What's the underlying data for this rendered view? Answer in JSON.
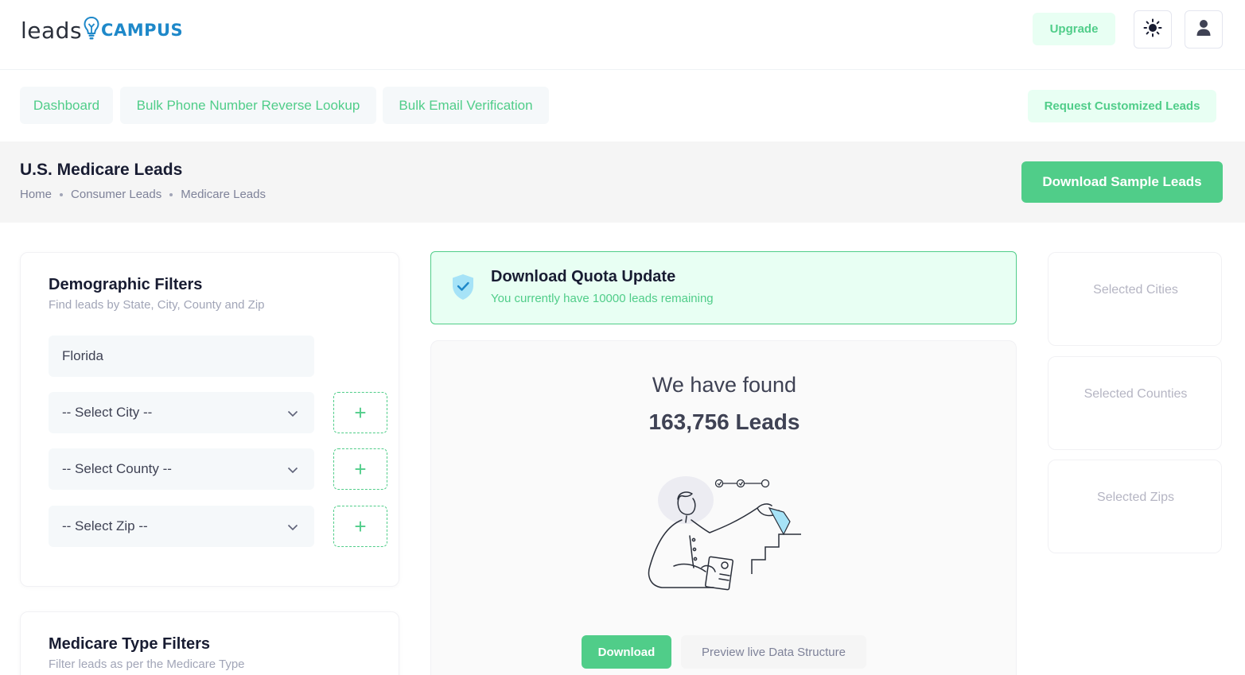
{
  "brand": {
    "logo_leads": "leads",
    "logo_campus": "CAMPUS"
  },
  "header": {
    "upgrade_label": "Upgrade",
    "theme_icon": "sun-icon",
    "user_icon": "user-icon"
  },
  "nav": {
    "tabs": [
      {
        "label": "Dashboard"
      },
      {
        "label": "Bulk Phone Number Reverse Lookup"
      },
      {
        "label": "Bulk Email Verification"
      }
    ],
    "request_label": "Request Customized Leads"
  },
  "toolbar": {
    "title": "U.S. Medicare Leads",
    "breadcrumb": [
      "Home",
      "Consumer Leads",
      "Medicare Leads"
    ],
    "sample_label": "Download Sample Leads"
  },
  "demographic": {
    "title": "Demographic Filters",
    "subtitle": "Find leads by State, City, County and Zip",
    "state_value": "Florida",
    "city_placeholder": "-- Select City --",
    "county_placeholder": "-- Select County --",
    "zip_placeholder": "-- Select Zip --",
    "add_symbol": "+"
  },
  "medicare_type": {
    "title": "Medicare Type Filters",
    "subtitle": "Filter leads as per the Medicare Type"
  },
  "quota": {
    "title": "Download Quota Update",
    "message": "You currently have 10000 leads remaining"
  },
  "results": {
    "found_label": "We have found",
    "count_label": "163,756 Leads",
    "download_label": "Download",
    "preview_label": "Preview live Data Structure"
  },
  "selected": {
    "cities_label": "Selected Cities",
    "counties_label": "Selected Counties",
    "zips_label": "Selected Zips"
  },
  "colors": {
    "accent": "#50cd89",
    "accent_light": "#e8fff3",
    "brand_blue": "#1e88c9"
  }
}
